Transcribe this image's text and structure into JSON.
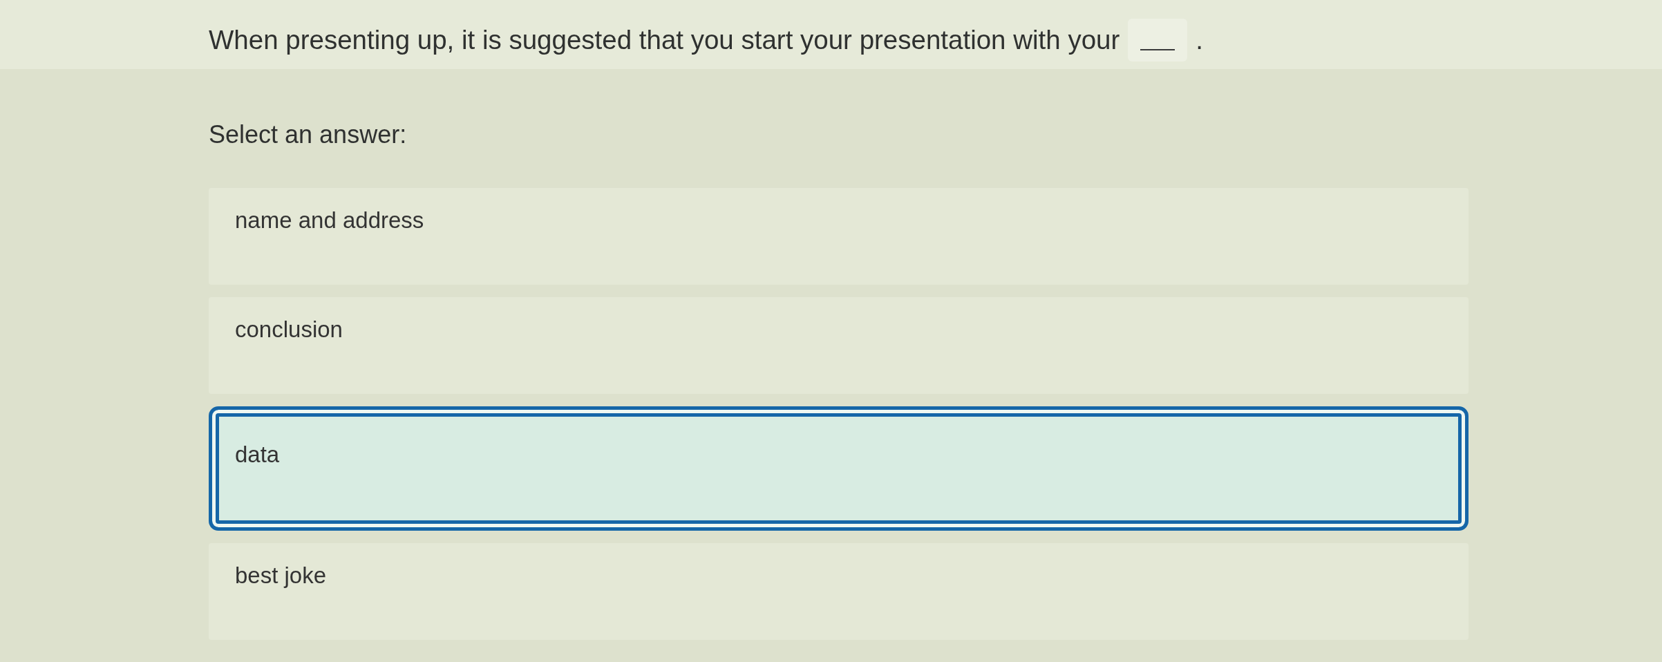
{
  "question": {
    "parts": [
      {
        "kind": "text",
        "text": "When presenting up, it is suggested that you start your presentation with your"
      },
      {
        "kind": "blank"
      },
      {
        "kind": "text",
        "text": "."
      }
    ]
  },
  "prompt": "Select an answer:",
  "options": [
    {
      "label": "name and address",
      "selected": false
    },
    {
      "label": "conclusion",
      "selected": false
    },
    {
      "label": "data",
      "selected": true
    },
    {
      "label": "best joke",
      "selected": false
    }
  ]
}
